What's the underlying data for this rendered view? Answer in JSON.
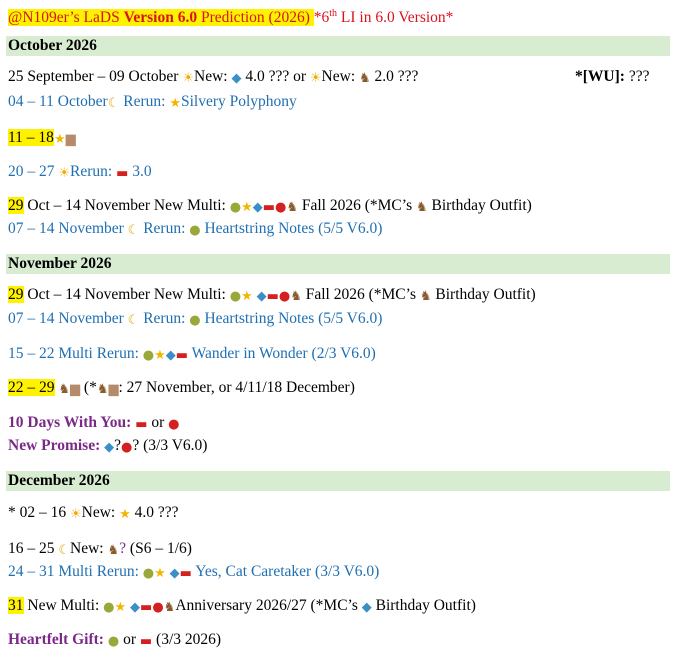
{
  "title": {
    "handle": "@N109er’s LaDS ",
    "version": "Version 6.0",
    "rest": " Prediction (2026) ",
    "note_prefix": "*6",
    "note_sup": "th",
    "note_suffix": " LI in 6.0 Version*"
  },
  "oct": {
    "header": "October 2026",
    "l1": {
      "a": "25 September – 09 October ",
      "b": "New: ",
      "c": " 4.0 ??? or ",
      "d": "New: ",
      "e": " 2.0 ???",
      "wu": "*[WU]:",
      "wu_val": " ???"
    },
    "l2": {
      "a": "04 – 11 October",
      "b": " Rerun: ",
      "c": "Silvery Polyphony"
    },
    "l3": {
      "a": "11 – 18"
    },
    "l4": {
      "a": "20 – 27 ",
      "b": "Rerun: ",
      "c": " 3.0"
    },
    "l5": {
      "hl": "29",
      "a": " Oct – 14 November New Multi: ",
      "b": " Fall 2026 (*MC’s ",
      "c": " Birthday Outfit)"
    },
    "l6": {
      "a": "07 – 14 November ",
      "b": " Rerun: ",
      "c": " Heartstring Notes (5/5 V6.0)"
    }
  },
  "nov": {
    "header": "November 2026",
    "l1": {
      "hl": "29",
      "a": " Oct – 14 November New Multi: ",
      "b": " Fall 2026 (*MC’s ",
      "c": " Birthday Outfit)"
    },
    "l2": {
      "a": "07 – 14 November ",
      "b": " Rerun: ",
      "c": " Heartstring Notes (5/5 V6.0)"
    },
    "l3": {
      "a": "15 – 22 Multi Rerun: ",
      "b": " Wander in Wonder (2/3 V6.0)"
    },
    "l4": {
      "hl": "22 – 29",
      "a": "  (*",
      "b": ": 27 November, or 4/11/18 December)"
    },
    "l5": {
      "a": "10 Days With You: ",
      "b": " or "
    },
    "l6": {
      "a": "New Promise: ",
      "b": "?",
      "c": "?    (3/3 V6.0)"
    }
  },
  "dec": {
    "header": "December 2026",
    "l1": {
      "a": "* 02  – 16 ",
      "b": "New: ",
      "c": " 4.0 ???"
    },
    "l2": {
      "a": "16 – 25 ",
      "b": "New: ",
      "c": "?",
      "d": "  (S6 – 1/6)"
    },
    "l3": {
      "a": "24 – 31 Multi Rerun: ",
      "b": " Yes, Cat Caretaker (3/3 V6.0)"
    },
    "l4": {
      "hl": "31",
      "a": " New Multi: ",
      "b": "Anniversary 2026/27 (*MC’s ",
      "c": " Birthday Outfit)"
    },
    "l5": {
      "a": "Heartfelt Gift: ",
      "b": "  or ",
      "c": "    (3/3 2026)"
    }
  },
  "icons": {
    "sun": "☀",
    "star": "★",
    "moon": "☾",
    "fish": "🐟",
    "horse": "♞",
    "car": "🚗",
    "apple": "●",
    "pear": "●",
    "cake": "▆"
  },
  "colors": {
    "band": "#d8ecd2",
    "highlight": "#fff200",
    "blue_text": "#1f6fb2",
    "purple_text": "#7a2a86",
    "red_text": "#d8141b"
  }
}
